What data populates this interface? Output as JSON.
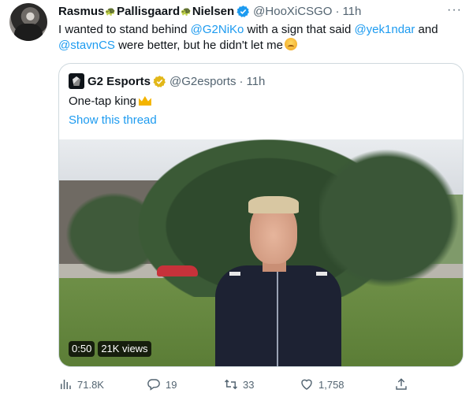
{
  "tweet": {
    "author": {
      "name_part1": "Rasmus",
      "name_part2": "Pallisgaard",
      "name_part3": "Nielsen",
      "handle": "@HooXiCSGO",
      "separator": "·",
      "time": "11h"
    },
    "text": {
      "part1": "I wanted to stand behind ",
      "mention1": "@G2NiKo",
      "part2": " with a sign that said ",
      "mention2": "@yek1ndar",
      "part3": " and",
      "mention3": "@stavnCS",
      "part4": " were better, but he didn't let me"
    },
    "more_icon": "more-dots-icon",
    "more_label": "···"
  },
  "quote": {
    "name": "G2 Esports",
    "handle": "@G2esports",
    "separator": "·",
    "time": "11h",
    "text": "One-tap king",
    "show_thread": "Show this thread",
    "video": {
      "duration": "0:50",
      "views": "21K views"
    }
  },
  "actions": {
    "views": "71.8K",
    "replies": "19",
    "retweets": "33",
    "likes": "1,758"
  },
  "colors": {
    "link": "#1d9bf0",
    "text": "#0f1419",
    "secondary": "#536471",
    "border": "#cfd9de",
    "verified_blue": "#1d9bf0",
    "verified_gold": "#e2b719"
  }
}
